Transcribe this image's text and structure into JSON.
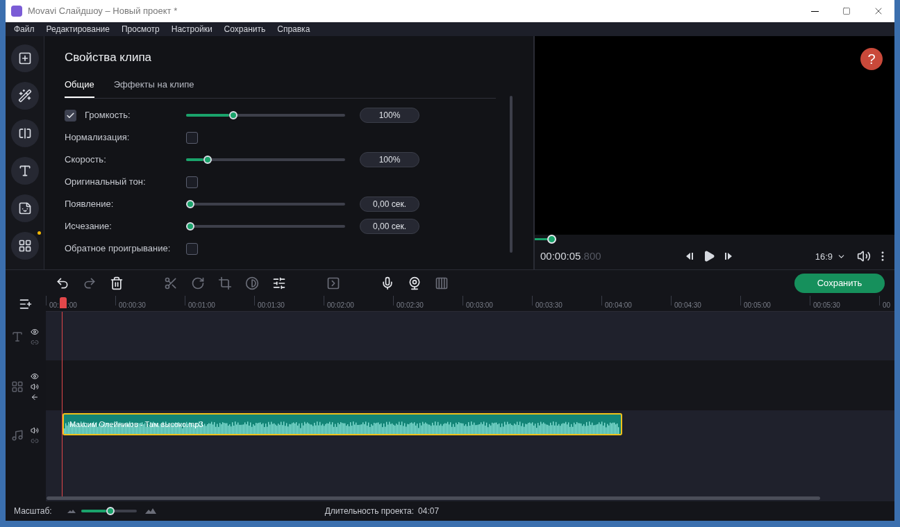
{
  "window": {
    "title": "Movavi Слайдшоу – Новый проект *"
  },
  "menu": [
    "Файл",
    "Редактирование",
    "Просмотр",
    "Настройки",
    "Сохранить",
    "Справка"
  ],
  "clip_properties": {
    "title": "Свойства клипа",
    "tabs": [
      {
        "label": "Общие",
        "selected": true
      },
      {
        "label": "Эффекты на клипе",
        "selected": false
      }
    ],
    "rows": [
      {
        "kind": "check_slider",
        "label": "Громкость:",
        "checked": true,
        "level": 0.27,
        "value": "100%"
      },
      {
        "kind": "checkbox",
        "label": "Нормализация:",
        "checked": false
      },
      {
        "kind": "slider",
        "label": "Скорость:",
        "level": 0.11,
        "value": "100%"
      },
      {
        "kind": "checkbox",
        "label": "Оригинальный тон:",
        "checked": false
      },
      {
        "kind": "slider",
        "label": "Появление:",
        "level": 0.0,
        "value": "0,00 сек."
      },
      {
        "kind": "slider",
        "label": "Исчезание:",
        "level": 0.0,
        "value": "0,00 сек."
      },
      {
        "kind": "checkbox",
        "label": "Обратное проигрывание:",
        "checked": false
      }
    ]
  },
  "preview": {
    "help": "?",
    "progress": {
      "level": 0.035
    },
    "timecode": "00:00:05",
    "timecode_ms": ".800",
    "aspect": "16:9"
  },
  "timeline": {
    "save_button": "Сохранить",
    "ruler_start": [
      "00:",
      ":00"
    ],
    "ruler": [
      "00:00:30",
      "00:01:00",
      "00:01:30",
      "00:02:00",
      "00:02:30",
      "00:03:00",
      "00:03:30",
      "00:04:00",
      "00:04:30",
      "00:05:00",
      "00:05:30",
      "00"
    ],
    "audio_clip": {
      "name": "Максим Олейников - Там высоко.mp3"
    }
  },
  "status": {
    "zoom_label": "Масштаб:",
    "zoom": {
      "level": 0.45
    },
    "duration_label": "Длительность проекта:",
    "duration": "04:07"
  }
}
